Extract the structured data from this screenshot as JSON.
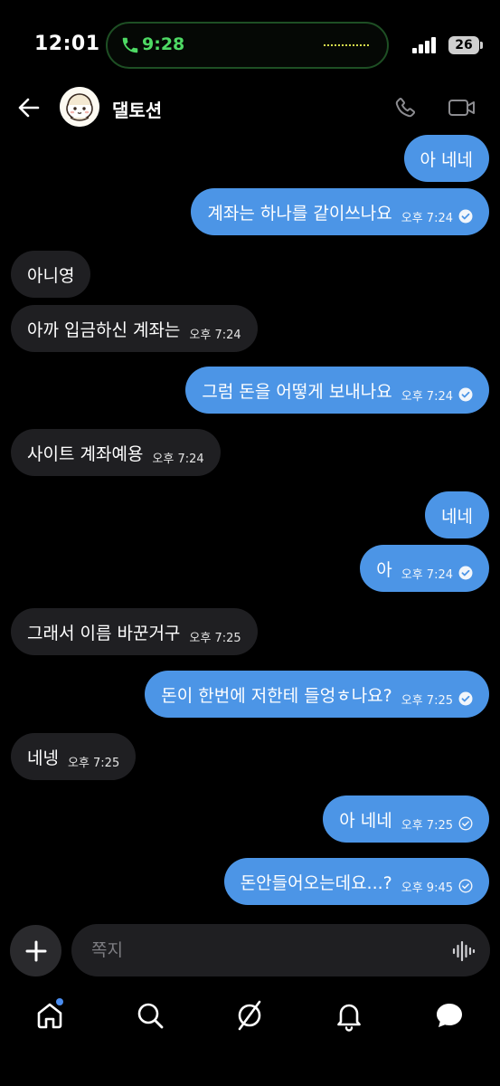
{
  "status_bar": {
    "time": "12:01",
    "call_time": "9:28",
    "battery": "26"
  },
  "header": {
    "contact_name": "댈토션",
    "icons": [
      "back-arrow-icon",
      "phone-icon",
      "video-camera-icon"
    ]
  },
  "messages": [
    {
      "direction": "out",
      "text": "아 네네",
      "time": "",
      "status": ""
    },
    {
      "direction": "out",
      "text": "계좌는 하나를 같이쓰나요",
      "time": "오후 7:24",
      "status": "read"
    },
    {
      "direction": "in",
      "text": "아니영",
      "time": ""
    },
    {
      "direction": "in",
      "text": "아까 입금하신 계좌는",
      "time": "오후 7:24"
    },
    {
      "direction": "out",
      "text": "그럼 돈을 어떻게 보내나요",
      "time": "오후 7:24",
      "status": "read"
    },
    {
      "direction": "in",
      "text": "사이트 계좌예용",
      "time": "오후 7:24"
    },
    {
      "direction": "out",
      "text": "네네",
      "time": "",
      "status": ""
    },
    {
      "direction": "out",
      "text": "아",
      "time": "오후 7:24",
      "status": "read"
    },
    {
      "direction": "in",
      "text": "그래서 이름 바꾼거구",
      "time": "오후 7:25"
    },
    {
      "direction": "out",
      "text": "돈이 한번에 저한테 들엉ㅎ나요?",
      "time": "오후 7:25",
      "status": "read"
    },
    {
      "direction": "in",
      "text": "네넹",
      "time": "오후 7:25"
    },
    {
      "direction": "out",
      "text": "아 네네",
      "time": "오후 7:25",
      "status": "sent"
    },
    {
      "direction": "out",
      "text": "돈안들어오는데요...?",
      "time": "오후 9:45",
      "status": "sent"
    }
  ],
  "composer": {
    "placeholder": "쪽지"
  },
  "tab_bar": {
    "items": [
      "home-icon",
      "search-icon",
      "explore-icon",
      "notifications-icon",
      "chat-icon"
    ],
    "home_has_badge": true
  },
  "colors": {
    "background": "#000000",
    "outgoing_bubble": "#4c95e6",
    "incoming_bubble": "#1f1f22",
    "call_green": "#4ed964",
    "badge_blue": "#4a8df0"
  }
}
